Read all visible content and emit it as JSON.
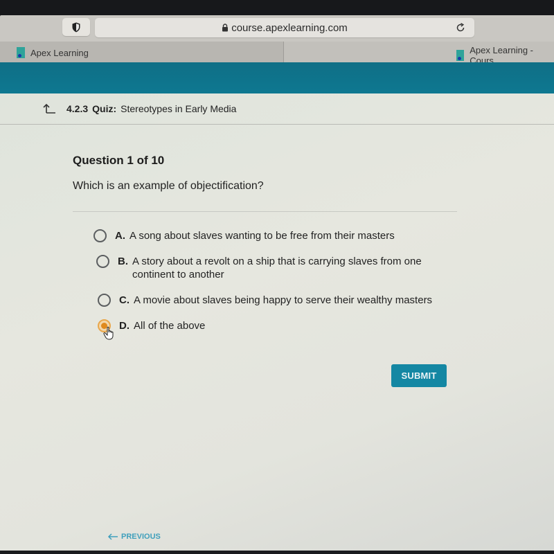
{
  "browser": {
    "url": "course.apexlearning.com",
    "tabs": [
      {
        "label": "Apex Learning",
        "active": true
      },
      {
        "label": "Apex Learning - Cours",
        "active": false
      }
    ]
  },
  "breadcrumb": {
    "number": "4.2.3",
    "type": "Quiz:",
    "title": "Stereotypes in Early Media"
  },
  "question": {
    "header": "Question 1 of 10",
    "text": "Which is an example of objectification?",
    "options": [
      {
        "letter": "A.",
        "text": "A song about slaves wanting to be free from their masters",
        "selected": false
      },
      {
        "letter": "B.",
        "text": "A story about a revolt on a ship that is carrying slaves from one continent to another",
        "selected": false
      },
      {
        "letter": "C.",
        "text": "A movie about slaves being happy to serve their wealthy masters",
        "selected": false
      },
      {
        "letter": "D.",
        "text": "All of the above",
        "selected": true
      }
    ]
  },
  "actions": {
    "submit_label": "SUBMIT",
    "previous_label": "PREVIOUS"
  },
  "colors": {
    "header_teal": "#0e7891",
    "submit_bg": "#1487a3",
    "selected_radio": "#e08a1e",
    "previous_link": "#3f9fbc"
  }
}
